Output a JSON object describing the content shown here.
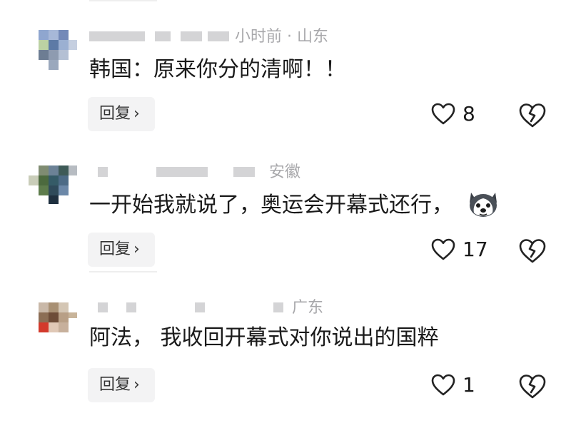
{
  "comments": [
    {
      "meta_partial": "小时前 · 山东",
      "text": "韩国：原来你分的清啊！！",
      "reply_label": "回复",
      "chevron": "›",
      "like_count": "8",
      "like_icon": "heart-outline-icon",
      "dislike_icon": "broken-heart-icon"
    },
    {
      "meta_partial": "安徽",
      "text": "一开始我就说了，奥运会开幕式还行，",
      "emoji": "husky-emoji-icon",
      "reply_label": "回复",
      "chevron": "›",
      "like_count": "17",
      "like_icon": "heart-outline-icon",
      "dislike_icon": "broken-heart-icon"
    },
    {
      "meta_partial": "广东",
      "text": "阿法， 我收回开幕式对你说出的国粹",
      "reply_label": "回复",
      "chevron": "›",
      "like_count": "1",
      "like_icon": "heart-outline-icon",
      "dislike_icon": "broken-heart-icon"
    }
  ],
  "colors": {
    "meta_text": "#a8a8ab",
    "content_text": "#1a1a1a",
    "reply_bg": "#f3f3f4",
    "icon_stroke": "#222222"
  }
}
